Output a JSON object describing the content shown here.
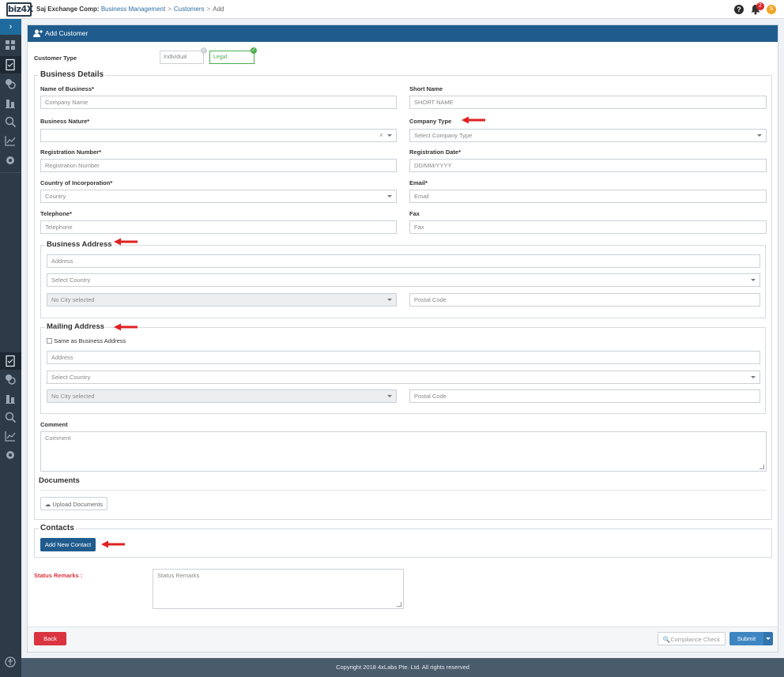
{
  "topbar": {
    "logo": "biz4X",
    "company": "Saj Exchange Comp:",
    "crumbs": [
      "Business Management",
      "Customers"
    ],
    "current": "Add",
    "notification_count": "2",
    "user_initial": "S"
  },
  "card": {
    "title": "Add Customer"
  },
  "customer_type": {
    "label": "Customer Type",
    "options": [
      "Individual",
      "Legal"
    ],
    "selected": "Legal"
  },
  "business_details": {
    "legend": "Business Details",
    "name_label": "Name of Business*",
    "name_placeholder": "Company Name",
    "short_label": "Short Name",
    "short_placeholder": "SHORT NAME",
    "nature_label": "Business Nature*",
    "nature_value": "",
    "ctype_label": "Company Type",
    "ctype_placeholder": "Select Company Type",
    "regno_label": "Registration Number*",
    "regno_placeholder": "Registration Number",
    "regdate_label": "Registration Date*",
    "regdate_placeholder": "DD/MM/YYYY",
    "country_label": "Country of Incorporation*",
    "country_placeholder": "Country",
    "email_label": "Email*",
    "email_placeholder": "Email",
    "tel_label": "Telephone*",
    "tel_placeholder": "Telephone",
    "fax_label": "Fax",
    "fax_placeholder": "Fax"
  },
  "business_address": {
    "legend": "Business Address",
    "address_placeholder": "Address",
    "country_placeholder": "Select Country",
    "city_placeholder": "No City selected",
    "postal_placeholder": "Postal Code"
  },
  "mailing_address": {
    "legend": "Mailing Address",
    "same_label": "Same as Business Address",
    "address_placeholder": "Address",
    "country_placeholder": "Select Country",
    "city_placeholder": "No City selected",
    "postal_placeholder": "Postal Code"
  },
  "comment": {
    "label": "Comment",
    "placeholder": "Comment"
  },
  "documents": {
    "legend": "Documents",
    "upload_label": "Upload Documents"
  },
  "contacts": {
    "legend": "Contacts",
    "add_label": "Add New Contact"
  },
  "status": {
    "label": "Status Remarks :",
    "placeholder": "Status Remarks"
  },
  "actions": {
    "back": "Back",
    "compliance": "Compliance Check",
    "submit": "Submit"
  },
  "footer": {
    "text": "Copyright 2018 4xLabs Pte. Ltd. All rights reserved"
  },
  "colors": {
    "header": "#1f5c8d",
    "sidebar": "#2d3a48",
    "danger": "#d9343f",
    "annotation_arrow": "#e02020"
  }
}
